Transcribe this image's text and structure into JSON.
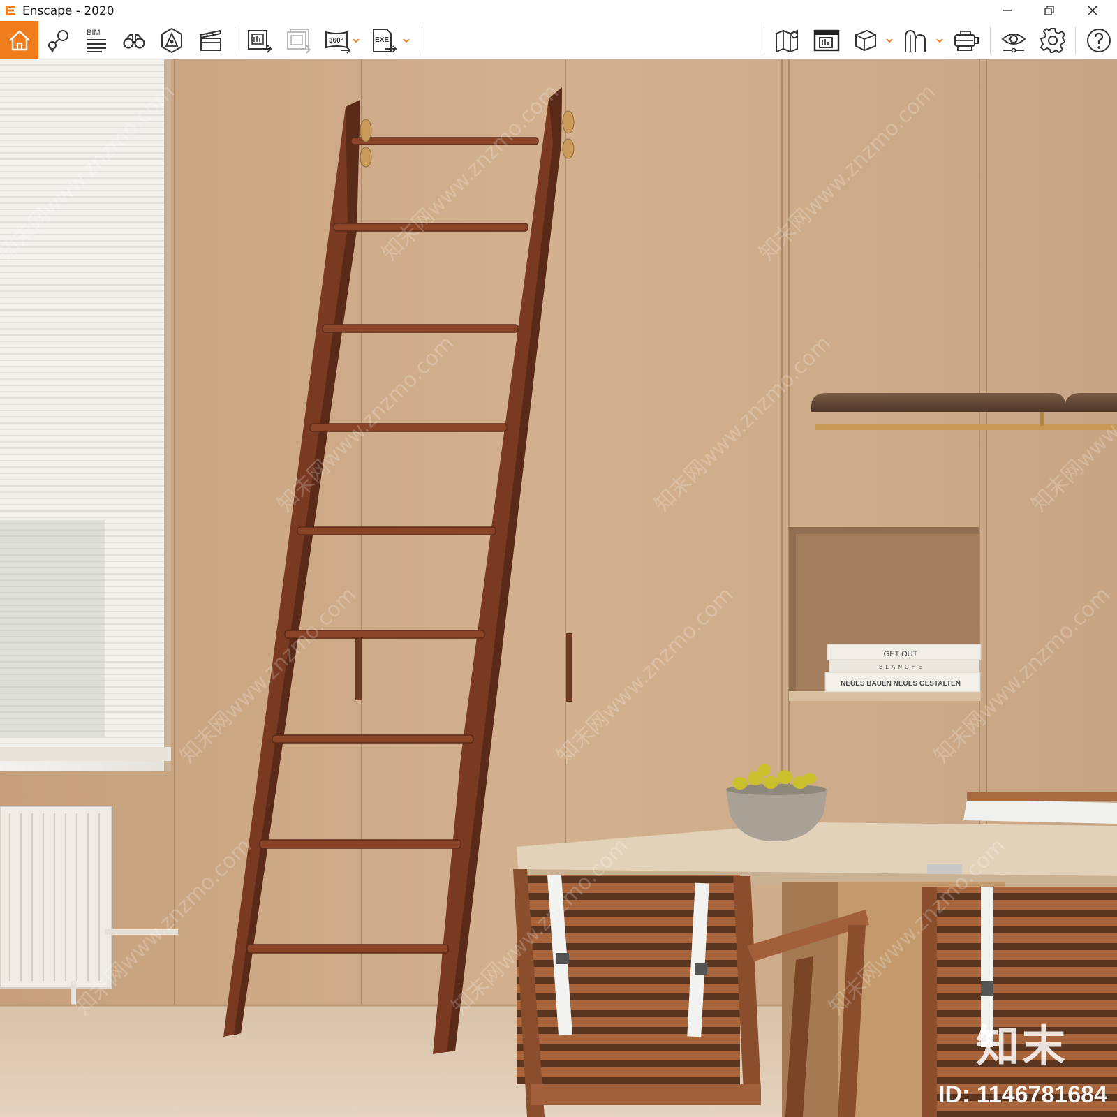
{
  "window": {
    "title": "Enscape - 2020",
    "controls": [
      "minimize",
      "restore",
      "close"
    ]
  },
  "toolbar": {
    "bim_label": "BIM",
    "panorama_label": "360°",
    "exe_label": "EXE",
    "left_icons": [
      "home-icon",
      "location-pin-icon",
      "bim-info-icon",
      "binoculars-icon",
      "light-view-icon",
      "video-editor-icon",
      "batch-render-icon",
      "screenshot-export-icon",
      "panorama-icon",
      "exe-export-icon"
    ],
    "right_icons": [
      "map-icon",
      "render-window-icon",
      "cube-view-icon",
      "asset-library-icon",
      "vr-headset-icon",
      "visual-settings-icon",
      "settings-icon",
      "help-icon"
    ],
    "accent_color": "#f07d1c"
  },
  "scene": {
    "books": [
      "GET OUT",
      "BLANCHE",
      "NEUES BAUEN NEUES GESTALTEN"
    ],
    "watermark_text": "知末网www.znzmo.com"
  },
  "watermark": {
    "brand": "知末",
    "id": "ID: 1146781684"
  }
}
